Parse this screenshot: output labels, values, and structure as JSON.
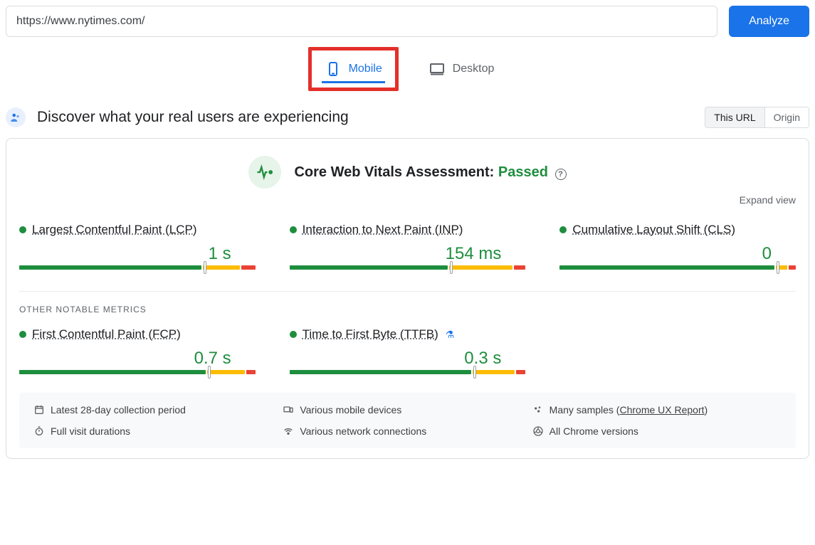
{
  "top": {
    "url_value": "https://www.nytimes.com/",
    "analyze_label": "Analyze"
  },
  "tabs": {
    "mobile_label": "Mobile",
    "desktop_label": "Desktop"
  },
  "real_users": {
    "title": "Discover what your real users are experiencing",
    "scope_this_url": "This URL",
    "scope_origin": "Origin"
  },
  "assessment": {
    "label": "Core Web Vitals Assessment:",
    "status": "Passed",
    "expand_label": "Expand view"
  },
  "metrics": {
    "lcp": {
      "name": "Largest Contentful Paint (LCP)",
      "value": "1 s"
    },
    "inp": {
      "name": "Interaction to Next Paint (INP)",
      "value": "154 ms"
    },
    "cls": {
      "name": "Cumulative Layout Shift (CLS)",
      "value": "0"
    },
    "other_header": "OTHER NOTABLE METRICS",
    "fcp": {
      "name": "First Contentful Paint (FCP)",
      "value": "0.7 s"
    },
    "ttfb": {
      "name": "Time to First Byte (TTFB)",
      "value": "0.3 s"
    }
  },
  "footer": {
    "period": "Latest 28-day collection period",
    "devices": "Various mobile devices",
    "samples_prefix": "Many samples (",
    "samples_link": "Chrome UX Report",
    "samples_suffix": ")",
    "durations": "Full visit durations",
    "connections": "Various network connections",
    "versions": "All Chrome versions"
  },
  "chart_data": [
    {
      "metric": "LCP",
      "type": "bar",
      "segments": [
        {
          "label": "good",
          "pct": 78
        },
        {
          "label": "needs-improvement",
          "pct": 16
        },
        {
          "label": "poor",
          "pct": 6
        }
      ],
      "marker_pct": 78
    },
    {
      "metric": "INP",
      "type": "bar",
      "segments": [
        {
          "label": "good",
          "pct": 68
        },
        {
          "label": "needs-improvement",
          "pct": 27
        },
        {
          "label": "poor",
          "pct": 5
        }
      ],
      "marker_pct": 68
    },
    {
      "metric": "CLS",
      "type": "bar",
      "segments": [
        {
          "label": "good",
          "pct": 92
        },
        {
          "label": "needs-improvement",
          "pct": 5
        },
        {
          "label": "poor",
          "pct": 3
        }
      ],
      "marker_pct": 92
    },
    {
      "metric": "FCP",
      "type": "bar",
      "segments": [
        {
          "label": "good",
          "pct": 80
        },
        {
          "label": "needs-improvement",
          "pct": 16
        },
        {
          "label": "poor",
          "pct": 4
        }
      ],
      "marker_pct": 80
    },
    {
      "metric": "TTFB",
      "type": "bar",
      "segments": [
        {
          "label": "good",
          "pct": 78
        },
        {
          "label": "needs-improvement",
          "pct": 18
        },
        {
          "label": "poor",
          "pct": 4
        }
      ],
      "marker_pct": 78
    }
  ]
}
